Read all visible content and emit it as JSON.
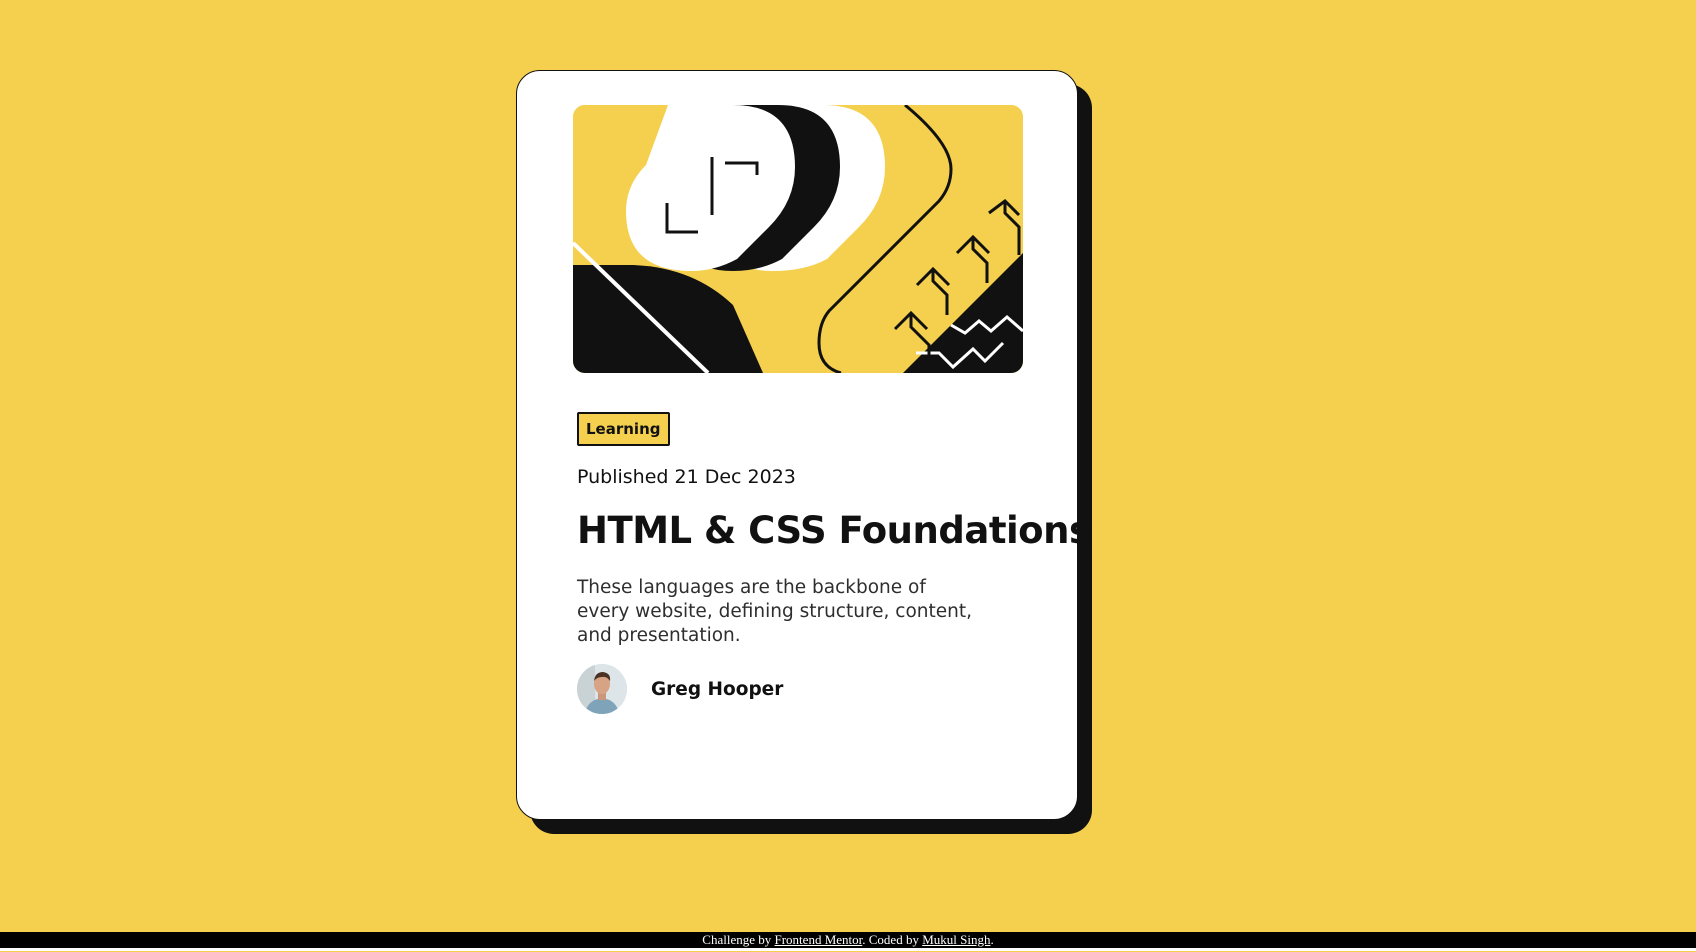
{
  "card": {
    "tag": "Learning",
    "published": "Published 21 Dec 2023",
    "title": "HTML & CSS Foundations",
    "description": "These languages are the backbone of every website, defining structure, content, and presentation.",
    "author": {
      "name": "Greg Hooper"
    }
  },
  "footer": {
    "prefix": "Challenge by ",
    "link1": "Frontend Mentor",
    "middle": ". Coded by ",
    "link2": "Mukul Singh",
    "suffix": "."
  },
  "colors": {
    "background": "#F4D04E",
    "card": "#FFFFFF",
    "ink": "#111111"
  },
  "icons": {
    "hero": "abstract-illustration",
    "avatar": "user-photo"
  }
}
